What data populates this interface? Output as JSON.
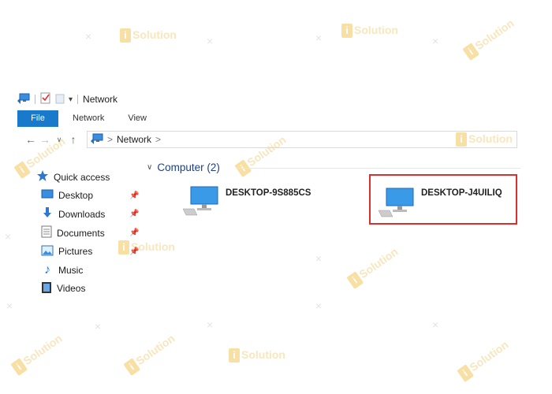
{
  "window": {
    "title": "Network"
  },
  "ribbon": {
    "tabs": [
      "File",
      "Network",
      "View"
    ]
  },
  "address": {
    "crumb": "Network",
    "separator": ">"
  },
  "sidebar": {
    "items": [
      {
        "label": "Quick access",
        "icon": "star-icon",
        "pinned": false
      },
      {
        "label": "Desktop",
        "icon": "desktop-folder-icon",
        "pinned": true
      },
      {
        "label": "Downloads",
        "icon": "downloads-icon",
        "pinned": true
      },
      {
        "label": "Documents",
        "icon": "documents-icon",
        "pinned": true
      },
      {
        "label": "Pictures",
        "icon": "pictures-icon",
        "pinned": true
      },
      {
        "label": "Music",
        "icon": "music-icon",
        "pinned": false
      },
      {
        "label": "Videos",
        "icon": "videos-icon",
        "pinned": false
      }
    ]
  },
  "content": {
    "group_label": "Computer (2)",
    "computers": [
      {
        "name": "DESKTOP-9S885CS"
      },
      {
        "name": "DESKTOP-J4UILIQ"
      }
    ]
  },
  "watermark": {
    "text": "Solution",
    "badge": "i"
  },
  "colors": {
    "accent": "#1979ca",
    "highlight": "#d9302f",
    "group": "#1e3f8f"
  }
}
